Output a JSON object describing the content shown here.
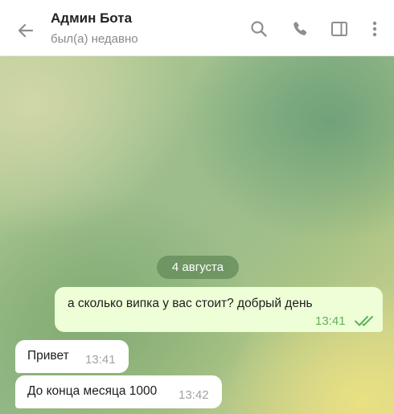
{
  "header": {
    "title": "Админ Бота",
    "status": "был(а) недавно",
    "icons": [
      "back-arrow-icon",
      "search-icon",
      "phone-icon",
      "sidebar-panel-icon",
      "more-vert-icon"
    ]
  },
  "chat": {
    "date_separator": "4 августа",
    "messages": [
      {
        "direction": "outgoing",
        "text": "а сколько випка у вас стоит? добрый день",
        "time": "13:41",
        "read": true
      },
      {
        "direction": "incoming",
        "text": "Привет",
        "time": "13:41"
      },
      {
        "direction": "incoming",
        "text": "До конца месяца 1000",
        "time": "13:42"
      }
    ]
  },
  "colors": {
    "outgoing_bubble": "#eefed7",
    "outgoing_time": "#5fb157",
    "incoming_bubble": "#ffffff",
    "date_pill": "#6f9760",
    "icon_gray": "#8e8e8e"
  }
}
